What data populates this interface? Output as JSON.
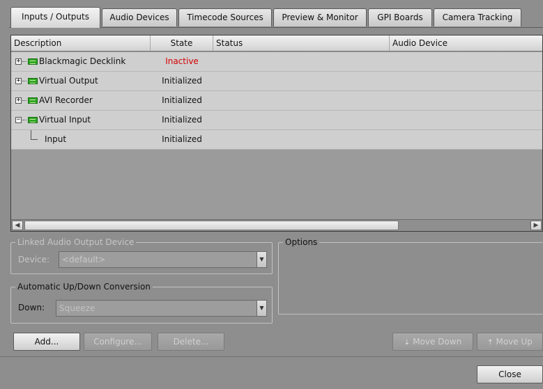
{
  "tabs": [
    {
      "label": "Inputs / Outputs",
      "active": true
    },
    {
      "label": "Audio Devices"
    },
    {
      "label": "Timecode Sources"
    },
    {
      "label": "Preview & Monitor"
    },
    {
      "label": "GPI Boards"
    },
    {
      "label": "Camera Tracking"
    }
  ],
  "table": {
    "columns": [
      "Description",
      "State",
      "Status",
      "Audio Device"
    ],
    "rows": [
      {
        "label": "Blackmagic Decklink",
        "state": "Inactive",
        "expander": "+",
        "icon": "device-board-icon"
      },
      {
        "label": "Virtual Output",
        "state": "Initialized",
        "expander": "+",
        "icon": "device-board-icon"
      },
      {
        "label": "AVI Recorder",
        "state": "Initialized",
        "expander": "+",
        "icon": "device-board-icon"
      },
      {
        "label": "Virtual Input",
        "state": "Initialized",
        "expander": "−",
        "icon": "device-board-icon"
      },
      {
        "label": "Input",
        "state": "Initialized",
        "child": true
      }
    ]
  },
  "scrollbar": {
    "left_arrow": "◀",
    "right_arrow": "▶"
  },
  "linked_audio": {
    "title": "Linked Audio Output Device",
    "device_label": "Device:",
    "device_value": "<default>"
  },
  "conversion": {
    "title": "Automatic Up/Down Conversion",
    "down_label": "Down:",
    "down_value": "Squeeze"
  },
  "options": {
    "title": "Options"
  },
  "buttons": {
    "add": "Add...",
    "configure": "Configure...",
    "delete": "Delete...",
    "move_down": "Move Down",
    "move_up": "Move Up",
    "close": "Close"
  },
  "colors": {
    "inactive_state": "#d40000",
    "background": "#8e8e8e"
  }
}
